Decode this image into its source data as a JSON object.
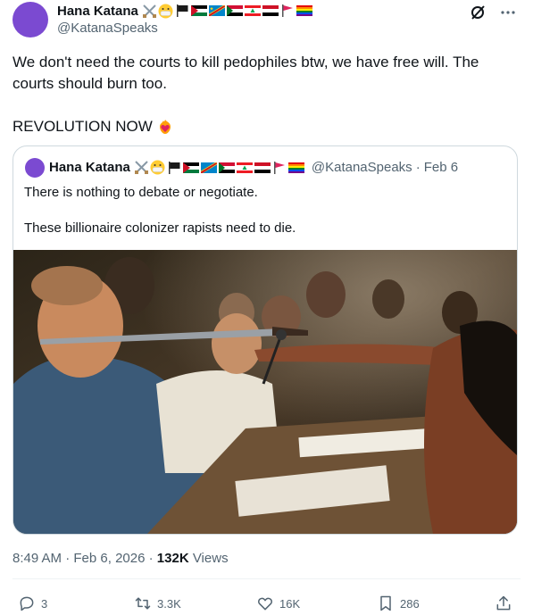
{
  "author": {
    "name": "Hana Katana",
    "handle": "@KatanaSpeaks",
    "avatar_color": "#7b4ad1",
    "emojis": [
      "crossed-swords",
      "face-with-mask",
      "black-flag",
      "flag-palestine",
      "flag-dr-congo",
      "flag-sudan",
      "flag-lebanon",
      "flag-yemen",
      "red-flag",
      "rainbow-flag"
    ]
  },
  "tweet": {
    "paragraph_1": "We don't need the courts to kill pedophiles btw, we have free will. The courts should burn too.",
    "paragraph_2": "REVOLUTION NOW",
    "paragraph_2_emoji": "heart-on-fire"
  },
  "quote": {
    "name": "Hana Katana",
    "handle": "@KatanaSpeaks",
    "separator": "·",
    "date": "Feb 6",
    "text_1": "There is nothing to debate or negotiate.",
    "text_2": "These billionaire colonizer rapists need to die."
  },
  "meta": {
    "time": "8:49 AM",
    "date": "Feb 6, 2026",
    "separator": "·",
    "views_count": "132K",
    "views_label": "Views"
  },
  "actions": {
    "replies": "3",
    "reposts": "3.3K",
    "likes": "16K",
    "bookmarks": "286"
  },
  "colors": {
    "text_primary": "#0f1419",
    "text_secondary": "#536471",
    "border": "#cfd9de"
  }
}
